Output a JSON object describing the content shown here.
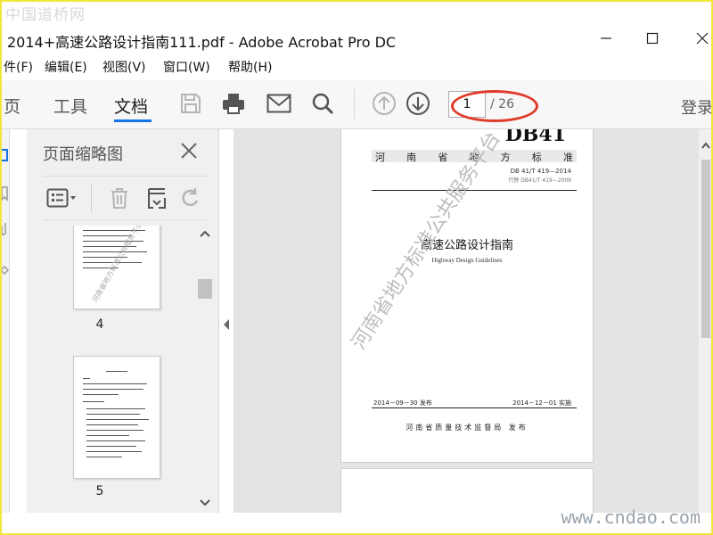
{
  "watermarks": {
    "top": "中国道桥网",
    "bottom": "www.cndao.com"
  },
  "window": {
    "title": "2014+高速公路设计指南111.pdf - Adobe Acrobat Pro DC"
  },
  "menu": [
    "件(F)",
    "编辑(E)",
    "视图(V)",
    "窗口(W)",
    "帮助(H)"
  ],
  "tabs": {
    "home": "页",
    "tools": "工具",
    "document": "文档"
  },
  "toolbar": {
    "icons": [
      "save-icon",
      "print-icon",
      "email-icon",
      "search-icon",
      "page-up-icon",
      "page-down-icon"
    ],
    "login": "登录"
  },
  "page_nav": {
    "current": "1",
    "total": "/ 26"
  },
  "accent_color": "#1473e6",
  "annotation_color": "#e03b2a",
  "thumbnail_panel": {
    "title": "页面缩略图",
    "thumbnails": [
      {
        "number": "4"
      },
      {
        "number": "5"
      }
    ]
  },
  "document_page": {
    "code": "DB41",
    "standard_label_chars": [
      "河",
      "南",
      "省",
      "地",
      "方",
      "标",
      "准"
    ],
    "standard_number": "DB 41/T 419—2014",
    "replaces": "代替 DB41/T 419—2009",
    "title_cn": "高速公路设计指南",
    "title_en": "Highway Design Guidelines",
    "publish_date": "2014－09－30 发布",
    "implement_date": "2014－12－01 实施",
    "issuer": "河南省质量技术监督局  发布",
    "watermark": "河南省地方标准公共服务平台"
  }
}
